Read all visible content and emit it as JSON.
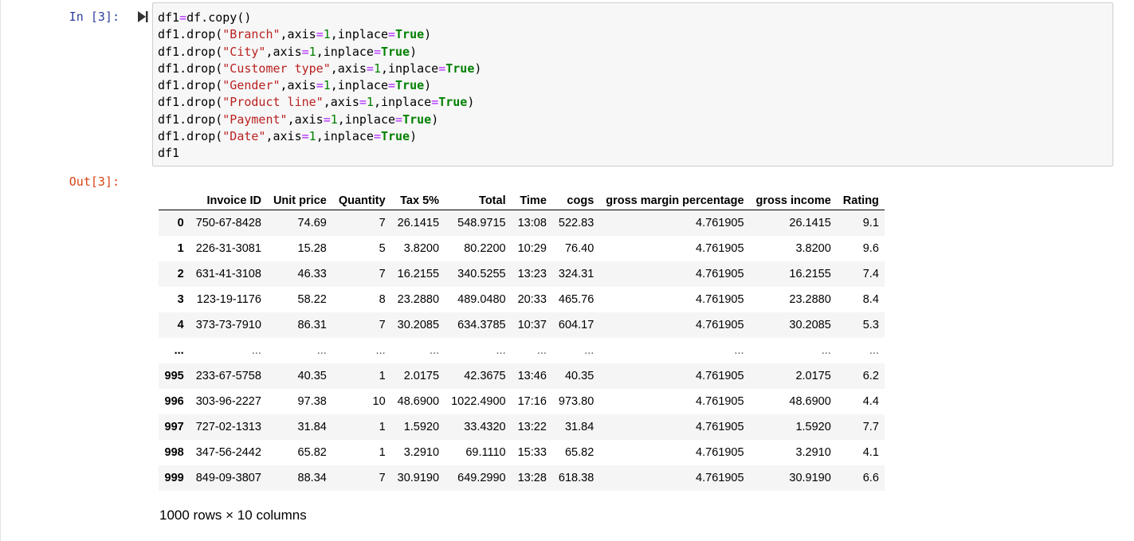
{
  "input_cell": {
    "prompt": "In [3]:",
    "code_lines": [
      [
        {
          "t": "df1"
        },
        {
          "t": "=",
          "c": "op"
        },
        {
          "t": "df.copy()"
        }
      ],
      [
        {
          "t": "df1.drop("
        },
        {
          "t": "\"Branch\"",
          "c": "str"
        },
        {
          "t": ",axis"
        },
        {
          "t": "=",
          "c": "op"
        },
        {
          "t": "1",
          "c": "num"
        },
        {
          "t": ",inplace"
        },
        {
          "t": "=",
          "c": "op"
        },
        {
          "t": "True",
          "c": "kw"
        },
        {
          "t": ")"
        }
      ],
      [
        {
          "t": "df1.drop("
        },
        {
          "t": "\"City\"",
          "c": "str"
        },
        {
          "t": ",axis"
        },
        {
          "t": "=",
          "c": "op"
        },
        {
          "t": "1",
          "c": "num"
        },
        {
          "t": ",inplace"
        },
        {
          "t": "=",
          "c": "op"
        },
        {
          "t": "True",
          "c": "kw"
        },
        {
          "t": ")"
        }
      ],
      [
        {
          "t": "df1.drop("
        },
        {
          "t": "\"Customer type\"",
          "c": "str"
        },
        {
          "t": ",axis"
        },
        {
          "t": "=",
          "c": "op"
        },
        {
          "t": "1",
          "c": "num"
        },
        {
          "t": ",inplace"
        },
        {
          "t": "=",
          "c": "op"
        },
        {
          "t": "True",
          "c": "kw"
        },
        {
          "t": ")"
        }
      ],
      [
        {
          "t": "df1.drop("
        },
        {
          "t": "\"Gender\"",
          "c": "str"
        },
        {
          "t": ",axis"
        },
        {
          "t": "=",
          "c": "op"
        },
        {
          "t": "1",
          "c": "num"
        },
        {
          "t": ",inplace"
        },
        {
          "t": "=",
          "c": "op"
        },
        {
          "t": "True",
          "c": "kw"
        },
        {
          "t": ")"
        }
      ],
      [
        {
          "t": "df1.drop("
        },
        {
          "t": "\"Product line\"",
          "c": "str"
        },
        {
          "t": ",axis"
        },
        {
          "t": "=",
          "c": "op"
        },
        {
          "t": "1",
          "c": "num"
        },
        {
          "t": ",inplace"
        },
        {
          "t": "=",
          "c": "op"
        },
        {
          "t": "True",
          "c": "kw"
        },
        {
          "t": ")"
        }
      ],
      [
        {
          "t": "df1.drop("
        },
        {
          "t": "\"Payment\"",
          "c": "str"
        },
        {
          "t": ",axis"
        },
        {
          "t": "=",
          "c": "op"
        },
        {
          "t": "1",
          "c": "num"
        },
        {
          "t": ",inplace"
        },
        {
          "t": "=",
          "c": "op"
        },
        {
          "t": "True",
          "c": "kw"
        },
        {
          "t": ")"
        }
      ],
      [
        {
          "t": "df1.drop("
        },
        {
          "t": "\"Date\"",
          "c": "str"
        },
        {
          "t": ",axis"
        },
        {
          "t": "=",
          "c": "op"
        },
        {
          "t": "1",
          "c": "num"
        },
        {
          "t": ",inplace"
        },
        {
          "t": "=",
          "c": "op"
        },
        {
          "t": "True",
          "c": "kw"
        },
        {
          "t": ")"
        }
      ],
      [
        {
          "t": "df1"
        }
      ]
    ],
    "run_icon": "run-cell-icon"
  },
  "output_cell": {
    "prompt": "Out[3]:",
    "table": {
      "columns": [
        "Invoice ID",
        "Unit price",
        "Quantity",
        "Tax 5%",
        "Total",
        "Time",
        "cogs",
        "gross margin percentage",
        "gross income",
        "Rating"
      ],
      "rows": [
        {
          "index": "0",
          "cells": [
            "750-67-8428",
            "74.69",
            "7",
            "26.1415",
            "548.9715",
            "13:08",
            "522.83",
            "4.761905",
            "26.1415",
            "9.1"
          ]
        },
        {
          "index": "1",
          "cells": [
            "226-31-3081",
            "15.28",
            "5",
            "3.8200",
            "80.2200",
            "10:29",
            "76.40",
            "4.761905",
            "3.8200",
            "9.6"
          ]
        },
        {
          "index": "2",
          "cells": [
            "631-41-3108",
            "46.33",
            "7",
            "16.2155",
            "340.5255",
            "13:23",
            "324.31",
            "4.761905",
            "16.2155",
            "7.4"
          ]
        },
        {
          "index": "3",
          "cells": [
            "123-19-1176",
            "58.22",
            "8",
            "23.2880",
            "489.0480",
            "20:33",
            "465.76",
            "4.761905",
            "23.2880",
            "8.4"
          ]
        },
        {
          "index": "4",
          "cells": [
            "373-73-7910",
            "86.31",
            "7",
            "30.2085",
            "634.3785",
            "10:37",
            "604.17",
            "4.761905",
            "30.2085",
            "5.3"
          ]
        },
        {
          "index": "...",
          "ellipsis": true,
          "cells": [
            "...",
            "...",
            "...",
            "...",
            "...",
            "...",
            "...",
            "...",
            "...",
            "..."
          ]
        },
        {
          "index": "995",
          "cells": [
            "233-67-5758",
            "40.35",
            "1",
            "2.0175",
            "42.3675",
            "13:46",
            "40.35",
            "4.761905",
            "2.0175",
            "6.2"
          ]
        },
        {
          "index": "996",
          "cells": [
            "303-96-2227",
            "97.38",
            "10",
            "48.6900",
            "1022.4900",
            "17:16",
            "973.80",
            "4.761905",
            "48.6900",
            "4.4"
          ]
        },
        {
          "index": "997",
          "cells": [
            "727-02-1313",
            "31.84",
            "1",
            "1.5920",
            "33.4320",
            "13:22",
            "31.84",
            "4.761905",
            "1.5920",
            "7.7"
          ]
        },
        {
          "index": "998",
          "cells": [
            "347-56-2442",
            "65.82",
            "1",
            "3.2910",
            "69.1110",
            "15:33",
            "65.82",
            "4.761905",
            "3.2910",
            "4.1"
          ]
        },
        {
          "index": "999",
          "cells": [
            "849-09-3807",
            "88.34",
            "7",
            "30.9190",
            "649.2990",
            "13:28",
            "618.38",
            "4.761905",
            "30.9190",
            "6.6"
          ]
        }
      ]
    },
    "shape_info": "1000 rows × 10 columns"
  }
}
